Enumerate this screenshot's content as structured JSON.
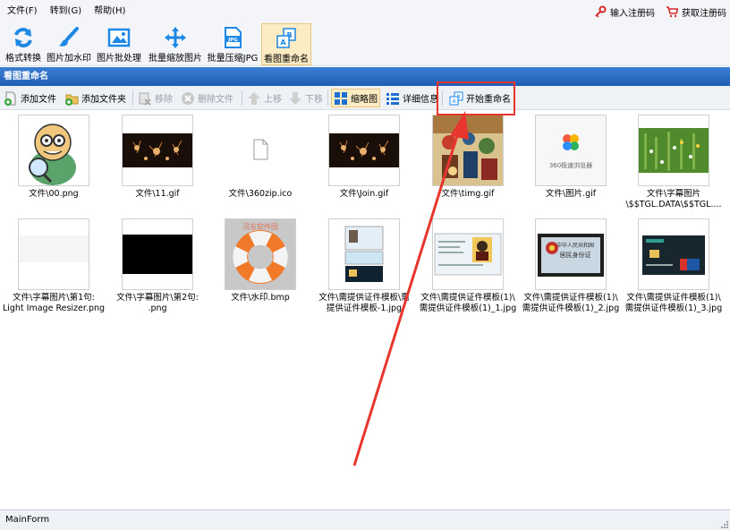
{
  "menu": {
    "items": [
      "文件(F)",
      "转到(G)",
      "帮助(H)"
    ],
    "register_input": "输入注册码",
    "get_register": "获取注册码"
  },
  "toolbar": {
    "items": [
      {
        "label": "格式转换",
        "icon": "rotate-arrows-icon"
      },
      {
        "label": "图片加水印",
        "icon": "paint-brush-icon"
      },
      {
        "label": "图片批处理",
        "icon": "picture-icon"
      },
      {
        "label": "批量缩放图片",
        "icon": "move-arrows-icon"
      },
      {
        "label": "批量压缩JPG",
        "icon": "jpg-file-icon"
      },
      {
        "label": "看图重命名",
        "icon": "rename-icon"
      }
    ],
    "active": "看图重命名"
  },
  "panel_title": "看图重命名",
  "subbar": {
    "add_file": "添加文件",
    "add_folder": "添加文件夹",
    "remove": "移除",
    "delete_file": "删除文件",
    "move_up": "上移",
    "move_down": "下移",
    "thumbnail": "缩略图",
    "detail": "详细信息",
    "start_rename": "开始重命名"
  },
  "files": [
    {
      "label": "文件\\00.png",
      "kind": "cartoon"
    },
    {
      "label": "文件\\11.gif",
      "kind": "fireworks"
    },
    {
      "label": "文件\\360zip.ico",
      "kind": "blank-file"
    },
    {
      "label": "文件\\Join.gif",
      "kind": "fireworks"
    },
    {
      "label": "文件\\timg.gif",
      "kind": "painting"
    },
    {
      "label": "文件\\图片.gif",
      "kind": "logo-360",
      "thumb_text": "360极速浏览器"
    },
    {
      "label": "文件\\字幕图片\n\\$$TGL.DATA\\$$TGL....",
      "kind": "grass"
    },
    {
      "label": "文件\\字幕图片\\第1句:\nLight Image Resizer.png",
      "kind": "light"
    },
    {
      "label": "文件\\字幕图片\\第2句:\n.png",
      "kind": "black"
    },
    {
      "label": "文件\\水印.bmp",
      "kind": "lifebuoy",
      "thumb_text": "河东软件园"
    },
    {
      "label": "文件\\需提供证件模板\\需\n提供证件模板-1.jpg",
      "kind": "id-collage"
    },
    {
      "label": "文件\\需提供证件模板(1)\\\n需提供证件模板(1)_1.jpg",
      "kind": "id-card"
    },
    {
      "label": "文件\\需提供证件模板(1)\\\n需提供证件模板(1)_2.jpg",
      "kind": "id-red",
      "thumb_text": "中华人民共和国\n居民身份证"
    },
    {
      "label": "文件\\需提供证件模板(1)\\\n需提供证件模板(1)_3.jpg",
      "kind": "bank-card"
    }
  ],
  "status": "MainForm",
  "colors": {
    "accent": "#1f5fb6",
    "highlight": "#e8362f",
    "active_bg": "#fcecc4"
  }
}
